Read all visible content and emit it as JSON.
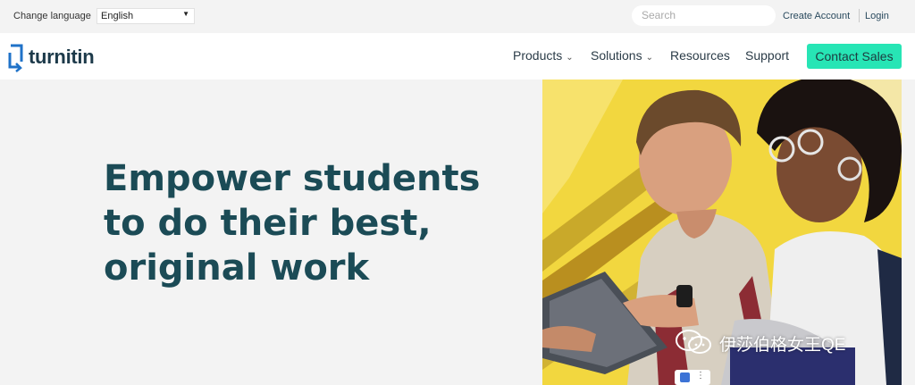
{
  "topbar": {
    "language_label": "Change language",
    "language_value": "English",
    "search_placeholder": "Search",
    "create_account": "Create Account",
    "login": "Login"
  },
  "nav": {
    "brand": "turnitin",
    "items": [
      {
        "label": "Products",
        "has_dropdown": true
      },
      {
        "label": "Solutions",
        "has_dropdown": true
      },
      {
        "label": "Resources",
        "has_dropdown": false
      },
      {
        "label": "Support",
        "has_dropdown": false
      }
    ],
    "cta": "Contact Sales"
  },
  "hero": {
    "headline_lines": [
      "Empower students",
      "to do their best,",
      "original work"
    ]
  },
  "watermark": {
    "text": "伊莎伯格女王QE"
  },
  "colors": {
    "accent": "#27e5b5",
    "headline": "#1b4b56",
    "brand": "#1d3a4a",
    "logo_blue": "#1f72c8",
    "photo_yellow": "#f2d73f"
  },
  "icons": [
    "chevron-down-icon",
    "caret-down-icon",
    "turnitin-logo-icon",
    "wechat-icon"
  ]
}
